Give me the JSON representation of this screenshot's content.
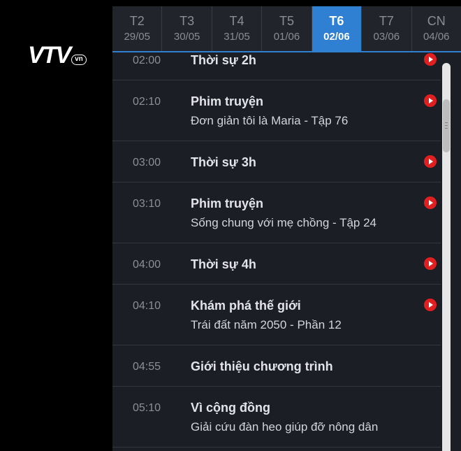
{
  "brand": {
    "logo_main": "VTV",
    "logo_sub": "vn"
  },
  "days": [
    {
      "day": "T2",
      "date": "29/05",
      "active": false
    },
    {
      "day": "T3",
      "date": "30/05",
      "active": false
    },
    {
      "day": "T4",
      "date": "31/05",
      "active": false
    },
    {
      "day": "T5",
      "date": "01/06",
      "active": false
    },
    {
      "day": "T6",
      "date": "02/06",
      "active": true
    },
    {
      "day": "T7",
      "date": "03/06",
      "active": false
    },
    {
      "day": "CN",
      "date": "04/06",
      "active": false
    }
  ],
  "schedule": [
    {
      "time": "02:00",
      "title": "Thời sự 2h",
      "subtitle": "",
      "play": true
    },
    {
      "time": "02:10",
      "title": "Phim truyện",
      "subtitle": "Đơn giản tôi là Maria - Tập 76",
      "play": true
    },
    {
      "time": "03:00",
      "title": "Thời sự 3h",
      "subtitle": "",
      "play": true
    },
    {
      "time": "03:10",
      "title": "Phim truyện",
      "subtitle": "Sống chung với mẹ chồng - Tập 24",
      "play": true
    },
    {
      "time": "04:00",
      "title": "Thời sự 4h",
      "subtitle": "",
      "play": true
    },
    {
      "time": "04:10",
      "title": "Khám phá thế giới",
      "subtitle": "Trái đất năm 2050 - Phần 12",
      "play": true
    },
    {
      "time": "04:55",
      "title": "Giới thiệu chương trình",
      "subtitle": "",
      "play": false
    },
    {
      "time": "05:10",
      "title": "Vì cộng đồng",
      "subtitle": "Giải cứu đàn heo giúp đỡ nông dân",
      "play": false
    }
  ],
  "colors": {
    "accent": "#2f7fd3",
    "play": "#e02020",
    "panel_bg": "#1c1e26"
  },
  "icons": {
    "play": "play-circle-icon",
    "scroll_grip": "scroll-grip-icon"
  }
}
